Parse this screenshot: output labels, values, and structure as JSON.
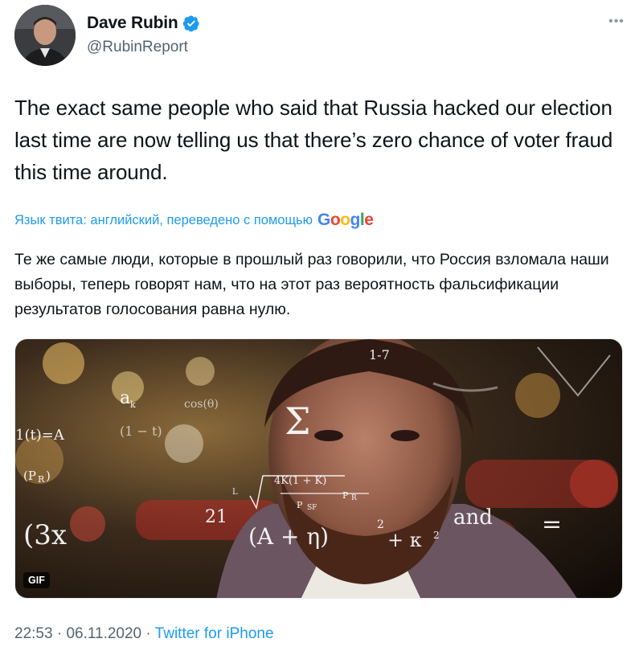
{
  "author": {
    "display_name": "Dave Rubin",
    "handle": "@RubinReport",
    "verified_icon": "verified-badge-icon"
  },
  "more_icon": "more-options-icon",
  "tweet": {
    "text": "The exact same people who said that Russia hacked our election last time are now telling us that there’s zero chance of voter fraud this time around."
  },
  "translation": {
    "notice": "Язык твита: английский, переведено с помощью",
    "provider_logo": "Google",
    "text": "Те же самые люди, которые в прошлый раз говорили, что Россия взломала наши выборы, теперь говорят нам, что на этот раз вероятность фальсификации результатов голосования равна нулю."
  },
  "media": {
    "badge": "GIF",
    "overlay_math": [
      "1-7",
      "a",
      "k",
      "cos(θ)",
      "1(t)=A",
      "(1 − t)",
      "(P",
      "R",
      ")",
      "(3x",
      "21",
      "(A + η)",
      "2",
      "+ κ",
      "2",
      "and",
      "=",
      "Σ",
      "4K(1 + K)",
      "P",
      "SF",
      "P",
      "R",
      "L"
    ]
  },
  "meta": {
    "time": "22:53",
    "separator": " · ",
    "date": "06.11.2020",
    "source": "Twitter for iPhone"
  },
  "colors": {
    "accent": "#1d9bf0",
    "text": "#0f1419",
    "muted": "#536471"
  }
}
